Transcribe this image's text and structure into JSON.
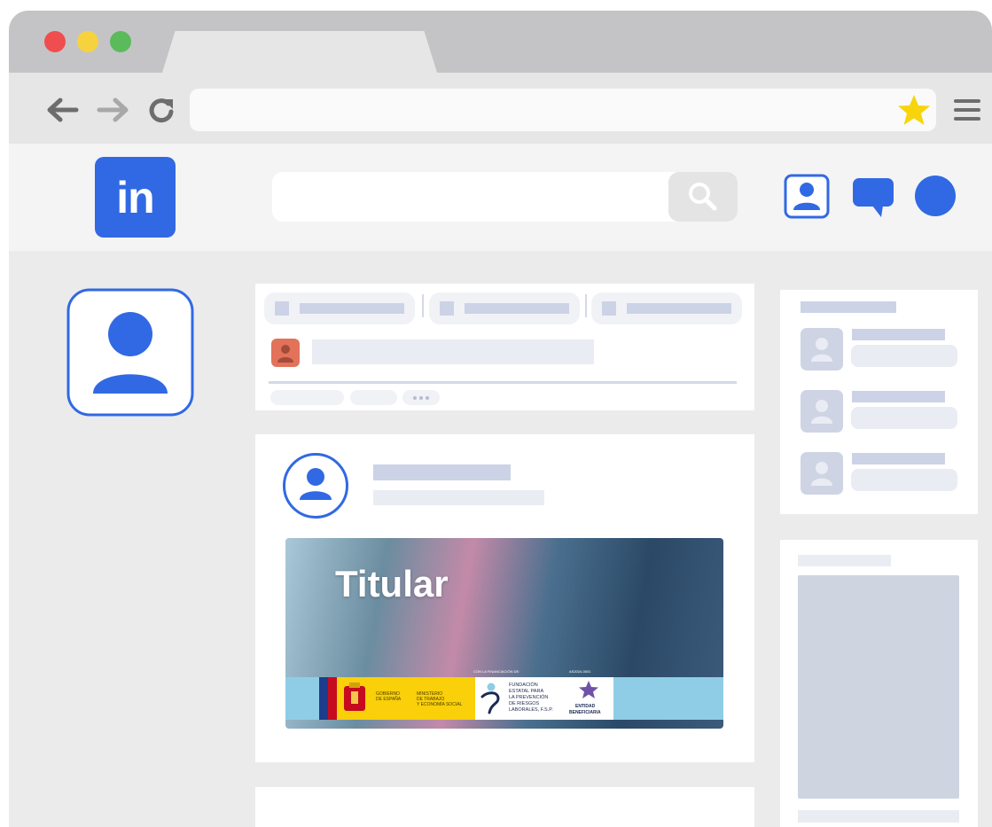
{
  "browser": {
    "dots": [
      "#f04d4f",
      "#f7d23f",
      "#5bbb5b"
    ],
    "url_value": ""
  },
  "app": {
    "logo_text": "in",
    "search_value": "",
    "brand_color": "#3069e3"
  },
  "post": {
    "image_title": "Titular",
    "funding": {
      "caption_left": "CON LA FINANCIACIÓN DE:",
      "caption_right": "AS2024-0001",
      "gov_line1": "GOBIERNO",
      "gov_line2": "DE ESPAÑA",
      "ministry_line1": "MINISTERIO",
      "ministry_line2": "DE TRABAJO",
      "ministry_line3": "Y ECONOMÍA SOCIAL",
      "fund_line1": "FUNDACIÓN",
      "fund_line2": "ESTATAL PARA",
      "fund_line3": "LA PREVENCIÓN",
      "fund_line4": "DE RIESGOS",
      "fund_line5": "LABORALES, F.S.P.",
      "entity_line1": "ENTIDAD",
      "entity_line2": "BENEFICIARIA"
    }
  },
  "icons": [
    "back-arrow-icon",
    "forward-arrow-icon",
    "reload-icon",
    "star-icon",
    "hamburger-menu-icon",
    "search-icon",
    "profile-icon",
    "chat-icon",
    "avatar-icon",
    "user-icon"
  ]
}
